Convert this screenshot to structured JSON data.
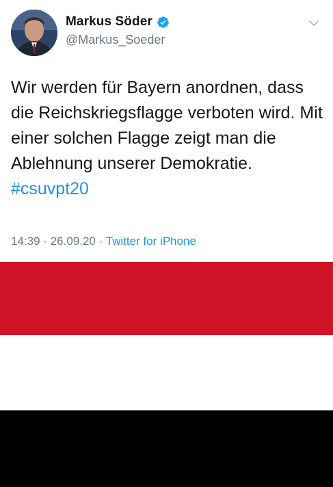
{
  "tweet": {
    "author": {
      "display_name": "Markus Söder",
      "handle": "@Markus_Soeder",
      "verified": true
    },
    "text_plain": "Wir werden für Bayern anordnen, dass die Reichskriegsflagge verboten wird. Mit einer solchen Flagge zeigt man die Ablehnung unserer Demokratie.",
    "hashtag": "#csuvpt20",
    "time": "14:39",
    "separator": "·",
    "date": "26.09.20",
    "source": "Twitter for iPhone"
  },
  "icons": {
    "verified": "verified-badge-icon",
    "caret": "chevron-down-icon"
  },
  "flag": {
    "stripes": [
      "#cf1427",
      "#ffffff",
      "#000000"
    ]
  },
  "colors": {
    "text": "#14171a",
    "muted": "#657786",
    "link": "#1b95e0",
    "verified_blue": "#1da1f2"
  }
}
